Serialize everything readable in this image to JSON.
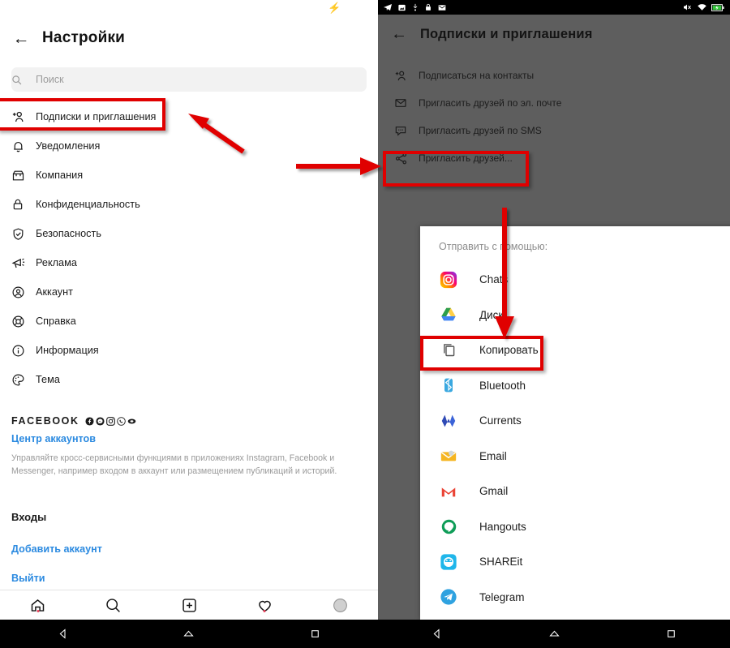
{
  "colors": {
    "accent_red": "#e00000",
    "link_blue": "#2b8ae0",
    "left_bg": "#ffffff",
    "right_bg": "#5e5e5e",
    "statusbar_black": "#000000",
    "search_bg": "#f2f2f2",
    "charge_green": "#3ec43e"
  },
  "left_phone": {
    "statusbar": {
      "charge_icon": "charging-bolt-icon"
    },
    "header": {
      "back_icon": "back-arrow-icon",
      "title": "Настройки"
    },
    "search": {
      "icon": "search-icon",
      "placeholder": "Поиск",
      "value": ""
    },
    "menu_items": [
      {
        "icon": "add-person-icon",
        "label": "Подписки и приглашения",
        "highlighted": true
      },
      {
        "icon": "bell-icon",
        "label": "Уведомления"
      },
      {
        "icon": "storefront-icon",
        "label": "Компания"
      },
      {
        "icon": "lock-icon",
        "label": "Конфиденциальность"
      },
      {
        "icon": "shield-check-icon",
        "label": "Безопасность"
      },
      {
        "icon": "megaphone-icon",
        "label": "Реклама"
      },
      {
        "icon": "account-circle-icon",
        "label": "Аккаунт"
      },
      {
        "icon": "lifebuoy-icon",
        "label": "Справка"
      },
      {
        "icon": "info-circle-icon",
        "label": "Информация"
      },
      {
        "icon": "palette-icon",
        "label": "Тема"
      }
    ],
    "facebook_block": {
      "brand": "FACEBOOK",
      "brand_icons": [
        "facebook-icon",
        "messenger-icon",
        "instagram-icon",
        "whatsapp-icon",
        "oculus-icon"
      ],
      "link": "Центр аккаунтов",
      "description": "Управляйте кросс-сервисными функциями в приложениях Instagram, Facebook и Messenger, например входом в аккаунт или размещением публикаций и историй."
    },
    "logins": {
      "heading": "Входы",
      "add_account": "Добавить аккаунт",
      "logout": "Выйти"
    },
    "tabbar": [
      {
        "icon": "home-icon",
        "badge": true
      },
      {
        "icon": "search-icon",
        "badge": false
      },
      {
        "icon": "plus-box-icon",
        "badge": false
      },
      {
        "icon": "heart-icon",
        "badge": true
      },
      {
        "icon": "avatar-icon",
        "badge": false
      }
    ],
    "navbar": [
      {
        "icon": "android-back-icon"
      },
      {
        "icon": "android-home-icon"
      },
      {
        "icon": "android-recents-icon"
      }
    ]
  },
  "right_phone": {
    "statusbar": {
      "left_icons": [
        "telegram-icon",
        "screenshot-icon",
        "usb-icon",
        "lock-icon",
        "mail-icon"
      ],
      "right_icons": [
        "volume-mute-icon",
        "wifi-icon",
        "battery-charging-icon"
      ]
    },
    "header": {
      "back_icon": "back-arrow-icon",
      "title": "Подписки и приглашения"
    },
    "menu_items": [
      {
        "icon": "add-person-icon",
        "label": "Подписаться на контакты"
      },
      {
        "icon": "envelope-icon",
        "label": "Пригласить друзей по эл. почте"
      },
      {
        "icon": "sms-bubble-icon",
        "label": "Пригласить друзей по SMS"
      },
      {
        "icon": "share-nodes-icon",
        "label": "Пригласить друзей...",
        "highlighted": true
      }
    ],
    "share_sheet": {
      "title": "Отправить с помощью:",
      "apps": [
        {
          "icon": "instagram-icon",
          "label": "Chats"
        },
        {
          "icon": "google-drive-icon",
          "label": "Диск"
        },
        {
          "icon": "copy-icon",
          "label": "Копировать",
          "highlighted": true
        },
        {
          "icon": "bluetooth-icon",
          "label": "Bluetooth"
        },
        {
          "icon": "google-currents-icon",
          "label": "Currents"
        },
        {
          "icon": "email-icon",
          "label": "Email"
        },
        {
          "icon": "gmail-icon",
          "label": "Gmail"
        },
        {
          "icon": "hangouts-icon",
          "label": "Hangouts"
        },
        {
          "icon": "shareit-icon",
          "label": "SHAREit"
        },
        {
          "icon": "telegram-icon",
          "label": "Telegram"
        }
      ]
    },
    "navbar": [
      {
        "icon": "android-back-icon"
      },
      {
        "icon": "android-home-icon"
      },
      {
        "icon": "android-recents-icon"
      }
    ]
  },
  "annotations": {
    "boxes": [
      {
        "name": "highlight-subscriptions-invites",
        "target": "Подписки и приглашения"
      },
      {
        "name": "highlight-invite-friends-share",
        "target": "Пригласить друзей..."
      },
      {
        "name": "highlight-copy",
        "target": "Копировать"
      }
    ],
    "arrows": [
      {
        "name": "arrow-to-subscriptions",
        "direction": "up-left"
      },
      {
        "name": "arrow-to-invite-friends",
        "direction": "right"
      },
      {
        "name": "arrow-to-copy",
        "direction": "down"
      }
    ]
  }
}
